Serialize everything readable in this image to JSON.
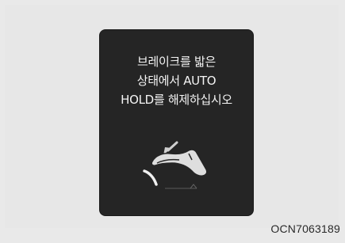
{
  "display": {
    "line1": "브레이크를 밟은",
    "line2": "상태에서 AUTO",
    "line3": "HOLD를 해제하십시오"
  },
  "icon": "brake-pedal-press-icon",
  "caption": "OCN7063189",
  "colors": {
    "panel": "#252525",
    "text": "#f4f4f4",
    "background": "#e9e9e9"
  }
}
